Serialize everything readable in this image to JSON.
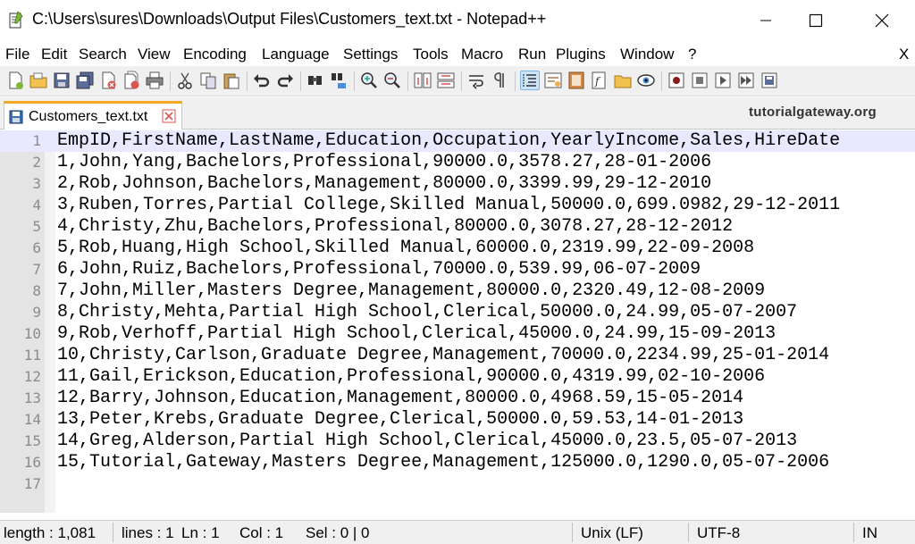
{
  "window": {
    "title": "C:\\Users\\sures\\Downloads\\Output Files\\Customers_text.txt - Notepad++"
  },
  "menu": {
    "items": [
      "File",
      "Edit",
      "Search",
      "View",
      "Encoding",
      "Language",
      "Settings",
      "Tools",
      "Macro",
      "Run",
      "Plugins",
      "Window",
      "?"
    ],
    "close_label": "X"
  },
  "tab": {
    "label": "Customers_text.txt"
  },
  "watermark": "tutorialgateway.org",
  "editor": {
    "current_line": 1,
    "lines": [
      {
        "num": "1",
        "text": "EmpID,FirstName,LastName,Education,Occupation,YearlyIncome,Sales,HireDate"
      },
      {
        "num": "2",
        "text": "1,John,Yang,Bachelors,Professional,90000.0,3578.27,28-01-2006"
      },
      {
        "num": "3",
        "text": "2,Rob,Johnson,Bachelors,Management,80000.0,3399.99,29-12-2010"
      },
      {
        "num": "4",
        "text": "3,Ruben,Torres,Partial College,Skilled Manual,50000.0,699.0982,29-12-2011"
      },
      {
        "num": "5",
        "text": "4,Christy,Zhu,Bachelors,Professional,80000.0,3078.27,28-12-2012"
      },
      {
        "num": "6",
        "text": "5,Rob,Huang,High School,Skilled Manual,60000.0,2319.99,22-09-2008"
      },
      {
        "num": "7",
        "text": "6,John,Ruiz,Bachelors,Professional,70000.0,539.99,06-07-2009"
      },
      {
        "num": "8",
        "text": "7,John,Miller,Masters Degree,Management,80000.0,2320.49,12-08-2009"
      },
      {
        "num": "9",
        "text": "8,Christy,Mehta,Partial High School,Clerical,50000.0,24.99,05-07-2007"
      },
      {
        "num": "10",
        "text": "9,Rob,Verhoff,Partial High School,Clerical,45000.0,24.99,15-09-2013"
      },
      {
        "num": "11",
        "text": "10,Christy,Carlson,Graduate Degree,Management,70000.0,2234.99,25-01-2014"
      },
      {
        "num": "12",
        "text": "11,Gail,Erickson,Education,Professional,90000.0,4319.99,02-10-2006"
      },
      {
        "num": "13",
        "text": "12,Barry,Johnson,Education,Management,80000.0,4968.59,15-05-2014"
      },
      {
        "num": "14",
        "text": "13,Peter,Krebs,Graduate Degree,Clerical,50000.0,59.53,14-01-2013"
      },
      {
        "num": "15",
        "text": "14,Greg,Alderson,Partial High School,Clerical,45000.0,23.5,05-07-2013"
      },
      {
        "num": "16",
        "text": "15,Tutorial,Gateway,Masters Degree,Management,125000.0,1290.0,05-07-2006"
      },
      {
        "num": "17",
        "text": ""
      }
    ]
  },
  "status": {
    "length": "length : 1,081",
    "lines": "lines : 1",
    "ln": "Ln : 1",
    "col": "Col : 1",
    "sel": "Sel : 0 | 0",
    "eol": "Unix (LF)",
    "encoding": "UTF-8",
    "mode": "IN"
  },
  "colors": {
    "tab_accent": "#f5a623",
    "current_line": "#e8e8ff",
    "gutter": "#e4e4e4",
    "line_number": "#8c8c8c"
  },
  "toolbar_icons": [
    "new-file-icon",
    "open-file-icon",
    "save-icon",
    "save-all-icon",
    "close-icon",
    "close-all-icon",
    "print-icon",
    "cut-icon",
    "copy-icon",
    "paste-icon",
    "undo-icon",
    "redo-icon",
    "find-icon",
    "replace-icon",
    "zoom-in-icon",
    "zoom-out-icon",
    "sync-vertical-icon",
    "sync-horizontal-icon",
    "word-wrap-icon",
    "show-all-chars-icon",
    "indent-guide-icon",
    "udl-icon",
    "document-map-icon",
    "function-list-icon",
    "folder-workspace-icon",
    "monitoring-icon",
    "record-macro-icon",
    "stop-macro-icon",
    "play-macro-icon",
    "run-multiple-macro-icon",
    "save-macro-icon"
  ]
}
